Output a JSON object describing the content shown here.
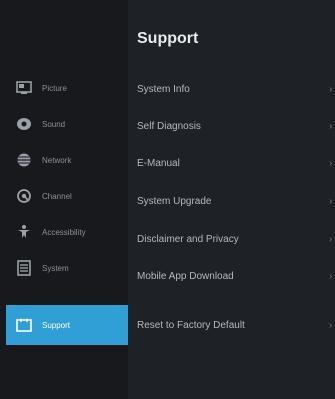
{
  "panel": {
    "title": "Support"
  },
  "sidebar": {
    "items": [
      {
        "label": "Picture",
        "icon": "picture-icon"
      },
      {
        "label": "Sound",
        "icon": "sound-icon"
      },
      {
        "label": "Network",
        "icon": "network-globe-icon"
      },
      {
        "label": "Channel",
        "icon": "channel-icon"
      },
      {
        "label": "Accessibility",
        "icon": "accessibility-icon"
      },
      {
        "label": "System",
        "icon": "system-icon"
      },
      {
        "label": "Support",
        "icon": "support-icon",
        "active": true
      }
    ]
  },
  "menu": {
    "items": [
      {
        "label": "System Info"
      },
      {
        "label": "Self Diagnosis"
      },
      {
        "label": "E-Manual"
      },
      {
        "label": "System Upgrade"
      },
      {
        "label": "Disclaimer and Privacy"
      },
      {
        "label": "Mobile App Download"
      },
      {
        "label": "Reset to Factory Default"
      }
    ]
  },
  "colors": {
    "accent": "#2f9fd6",
    "background": "#1e2126",
    "sidebar": "#17191d"
  }
}
